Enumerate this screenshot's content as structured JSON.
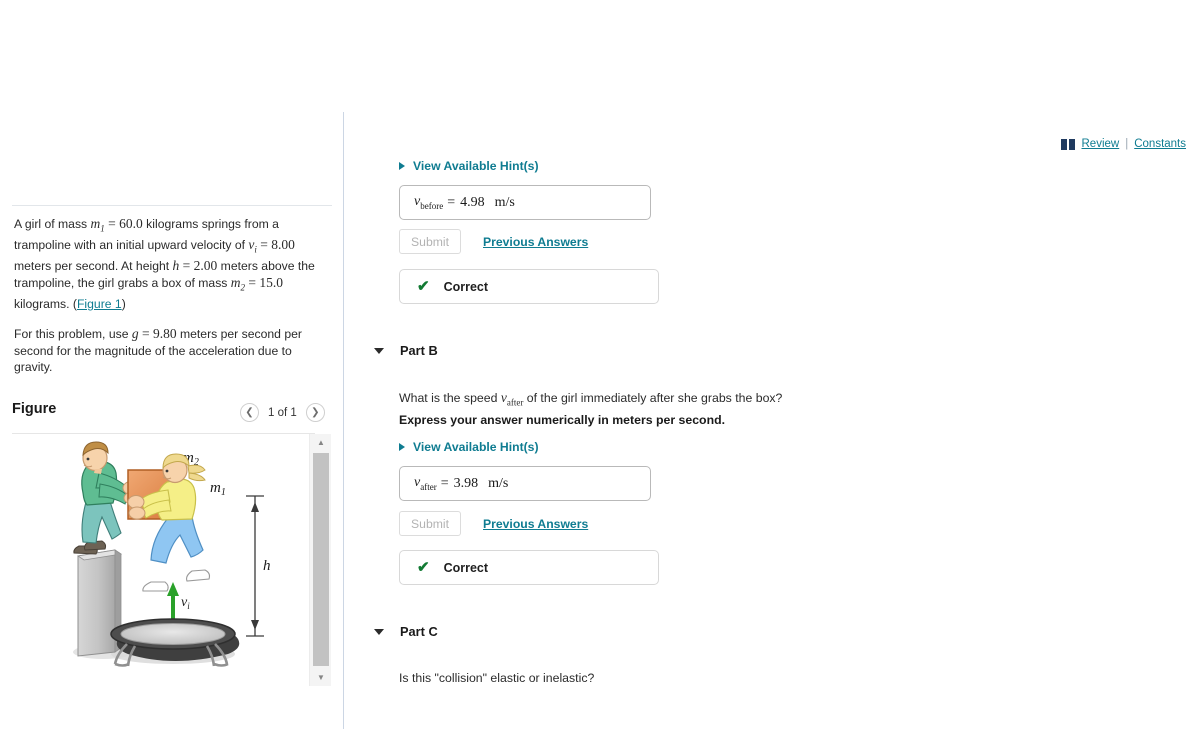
{
  "topbar": {
    "book_icon": "book-icon",
    "review_label": "Review",
    "separator": "|",
    "constants_label": "Constants",
    "link_color": "#0f7c91"
  },
  "problem": {
    "line1_a": "A girl of mass ",
    "m1_sym": "m",
    "m1_sub": "1",
    "m1_eq": "=",
    "m1_val": "60.0",
    "line1_b": " kilograms springs from a trampoline with an initial upward velocity of ",
    "vi_sym": "v",
    "vi_sub": "i",
    "vi_eq": "=",
    "vi_val": "8.00",
    "line1_c": " meters per second. At height ",
    "h_sym": "h",
    "h_eq": "=",
    "h_val": "2.00",
    "line1_d": " meters above the trampoline, the girl grabs a box of mass ",
    "m2_sym": "m",
    "m2_sub": "2",
    "m2_eq": "=",
    "m2_val": "15.0",
    "line1_e": " kilograms. (",
    "figure_link": "Figure 1",
    "line1_f": ")",
    "line2_a": "For this problem, use ",
    "g_sym": "g",
    "g_eq": "=",
    "g_val": "9.80",
    "line2_b": " meters per second per second for the magnitude of the acceleration due to gravity."
  },
  "figure_panel": {
    "title": "Figure",
    "prev_icon": "chevron-left-icon",
    "next_icon": "chevron-right-icon",
    "counter": "1 of 1",
    "scroll_up_icon": "triangle-up-icon",
    "scroll_down_icon": "triangle-down-icon",
    "labels": {
      "m2": "m",
      "m2_sub": "2",
      "m1": "m",
      "m1_sub": "1",
      "h": "h",
      "vi": "v",
      "vi_sub": "i"
    },
    "colors": {
      "box": "#e08a4e",
      "arrow": "#2aa12a",
      "boy_shirt": "#62bc92",
      "boy_pants": "#6fbfb8",
      "girl_shirt": "#f3ee84",
      "girl_pants": "#8fc6f2",
      "pedestal": "#c3c3c3",
      "trampoline": "#4d4d4d"
    }
  },
  "partA": {
    "hint_label": "View Available Hint(s)",
    "hint_icon": "triangle-right-icon",
    "answer": {
      "symbol": "v",
      "subscript": "before",
      "equals": "=",
      "value": "4.98",
      "unit": "m/s"
    },
    "submit_label": "Submit",
    "previous_answers_label": "Previous Answers",
    "status_icon": "check-icon",
    "status_label": "Correct",
    "status_color": "#127a33"
  },
  "partB": {
    "toggle_icon": "triangle-down-icon",
    "title": "Part B",
    "question_a": "What is the speed ",
    "question_sym": "v",
    "question_sub": "after",
    "question_b": " of the girl immediately after she grabs the box?",
    "instruction": "Express your answer numerically in meters per second.",
    "hint_label": "View Available Hint(s)",
    "hint_icon": "triangle-right-icon",
    "answer": {
      "symbol": "v",
      "subscript": "after",
      "equals": "=",
      "value": "3.98",
      "unit": "m/s"
    },
    "submit_label": "Submit",
    "previous_answers_label": "Previous Answers",
    "status_icon": "check-icon",
    "status_label": "Correct",
    "status_color": "#127a33"
  },
  "partC": {
    "toggle_icon": "triangle-down-icon",
    "title": "Part C",
    "question": "Is this \"collision\" elastic or inelastic?"
  }
}
